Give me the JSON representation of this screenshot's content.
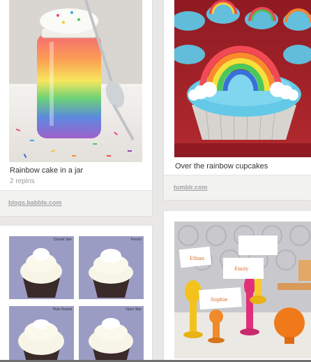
{
  "pins": [
    {
      "caption": "Rainbow cake in a jar",
      "repins": "2 repins",
      "source": "blogs.babble.com",
      "image_alt": "Layered rainbow cake in a mason jar with sprinkles and a spoon"
    },
    {
      "caption": "Over the rainbow cupcakes",
      "source": "tumblr.com",
      "image_alt": "Blue frosted cupcakes topped with candy rainbows and marshmallow clouds"
    },
    {
      "grid": [
        {
          "label": "Closed Star"
        },
        {
          "label": "French"
        },
        {
          "label": "Plain Round"
        },
        {
          "label": "Open Star"
        }
      ],
      "image_alt": "Four cupcakes showing different frosting piping tips"
    },
    {
      "image_alt": "Colorful wooden place card holders with name cards",
      "cards": [
        "Ethan",
        "Emily",
        "Sophie"
      ]
    }
  ],
  "colors": {
    "background": "#e9e8e6",
    "card": "#ffffff",
    "source_strip": "#f2f2f1",
    "link": "#a3a3a3"
  }
}
